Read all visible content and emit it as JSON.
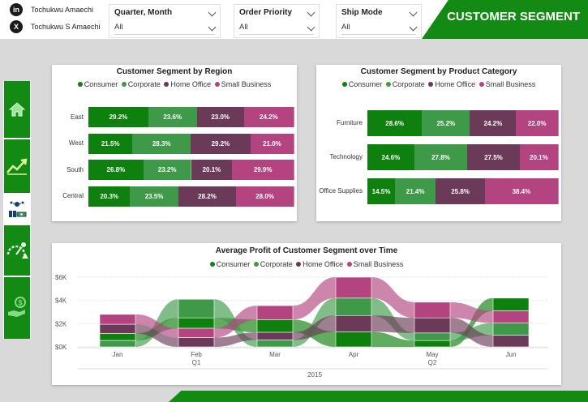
{
  "header": {
    "title": "CUSTOMER SEGMENT"
  },
  "social": [
    {
      "icon": "linkedin-icon",
      "glyph": "in",
      "label": "Tochukwu Amaechi"
    },
    {
      "icon": "x-icon",
      "glyph": "X",
      "label": "Tochukwu S Amaechi"
    }
  ],
  "filters": [
    {
      "label": "Quarter, Month",
      "value": "All"
    },
    {
      "label": "Order Priority",
      "value": "All"
    },
    {
      "label": "Ship Mode",
      "value": "All"
    }
  ],
  "nav": [
    {
      "name": "home-icon",
      "active": false
    },
    {
      "name": "trend-chart-icon",
      "active": false
    },
    {
      "name": "customer-segment-icon",
      "active": true
    },
    {
      "name": "shipping-risk-icon",
      "active": false
    },
    {
      "name": "profit-hand-icon",
      "active": false
    }
  ],
  "colors": {
    "Consumer": "#0e800e",
    "Corporate": "#3e9a48",
    "Home Office": "#6b3a58",
    "Small Business": "#b3447f"
  },
  "chart_data": [
    {
      "type": "bar",
      "stacking": "percent",
      "orientation": "horizontal",
      "title": "Customer Segment by Region",
      "categories": [
        "East",
        "West",
        "South",
        "Central"
      ],
      "series": [
        {
          "name": "Consumer",
          "values": [
            29.2,
            21.5,
            26.8,
            20.3
          ]
        },
        {
          "name": "Corporate",
          "values": [
            23.6,
            28.3,
            23.2,
            23.5
          ]
        },
        {
          "name": "Home Office",
          "values": [
            23.0,
            29.2,
            20.1,
            28.2
          ]
        },
        {
          "name": "Small Business",
          "values": [
            24.2,
            21.0,
            29.9,
            28.0
          ]
        }
      ],
      "legend": "top"
    },
    {
      "type": "bar",
      "stacking": "percent",
      "orientation": "horizontal",
      "title": "Customer Segment by Product Category",
      "categories": [
        "Furniture",
        "Technology",
        "Office Supplies"
      ],
      "series": [
        {
          "name": "Consumer",
          "values": [
            28.6,
            24.6,
            14.5
          ]
        },
        {
          "name": "Corporate",
          "values": [
            25.2,
            27.8,
            21.4
          ]
        },
        {
          "name": "Home Office",
          "values": [
            24.2,
            27.5,
            25.8
          ]
        },
        {
          "name": "Small Business",
          "values": [
            22.0,
            20.1,
            38.4
          ]
        }
      ],
      "legend": "top"
    },
    {
      "type": "area",
      "subtype": "ribbon",
      "title": "Average Profit of Customer Segment over Time",
      "x": [
        "Jan",
        "Feb",
        "Mar",
        "Apr",
        "May",
        "Jun"
      ],
      "x_groups": [
        {
          "label": "Q1",
          "under": "Feb"
        },
        {
          "label": "Q2",
          "under": "May"
        }
      ],
      "x_year": "2015",
      "y_ticks": [
        "$6K",
        "$4K",
        "$2K",
        "$0K"
      ],
      "ylim": [
        0,
        6000
      ],
      "series": [
        {
          "name": "Consumer",
          "values": [
            600,
            900,
            1100,
            1300,
            550,
            1100
          ]
        },
        {
          "name": "Corporate",
          "values": [
            550,
            1600,
            600,
            1500,
            650,
            1050
          ]
        },
        {
          "name": "Home Office",
          "values": [
            800,
            800,
            650,
            1400,
            1300,
            1000
          ]
        },
        {
          "name": "Small Business",
          "values": [
            850,
            800,
            1200,
            1800,
            1350,
            1050
          ]
        }
      ],
      "legend": "top"
    }
  ]
}
